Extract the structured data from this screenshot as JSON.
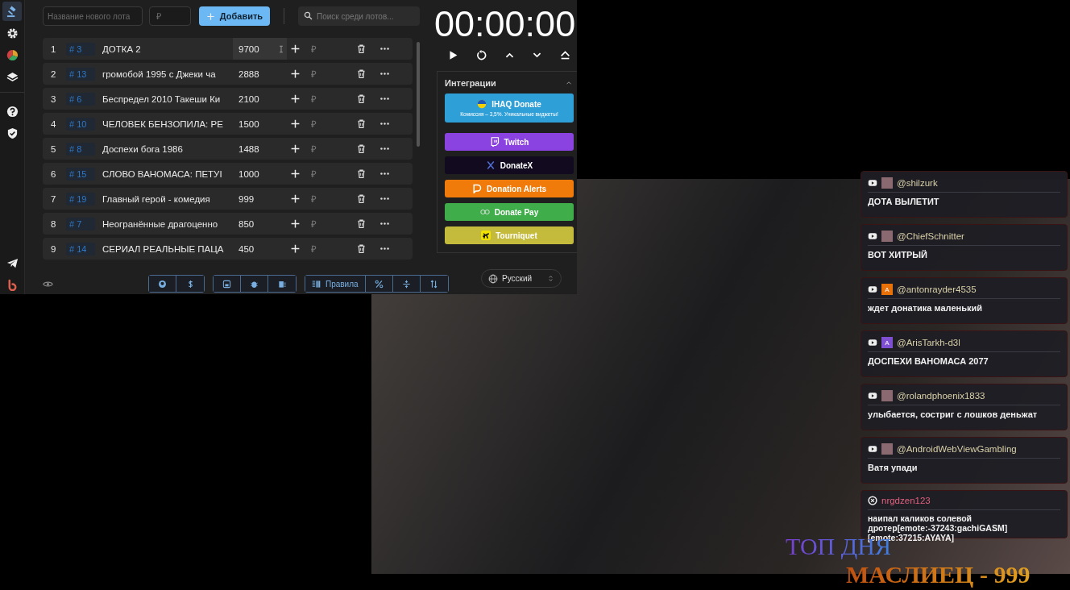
{
  "sidebar": {
    "items": [
      {
        "kind": "gavel",
        "selected": true
      },
      {
        "kind": "gear",
        "selected": false
      },
      {
        "kind": "pie",
        "selected": false
      },
      {
        "kind": "layers",
        "selected": false
      },
      {
        "kind": "help",
        "selected": false
      },
      {
        "kind": "shield",
        "selected": false
      },
      {
        "kind": "telegram",
        "selected": false
      },
      {
        "kind": "brand",
        "selected": false
      }
    ]
  },
  "new_lot": {
    "name_placeholder": "Название нового лота",
    "amount_placeholder": "₽",
    "add_button": "Добавить"
  },
  "search": {
    "placeholder": "Поиск среди лотов..."
  },
  "lots": [
    {
      "index": "1",
      "number": "# 3",
      "name": "ДОТКА 2",
      "amount": "9700",
      "highlighted": true
    },
    {
      "index": "2",
      "number": "# 13",
      "name": "громобой 1995 с Джеки ча",
      "amount": "2888",
      "highlighted": false
    },
    {
      "index": "3",
      "number": "# 6",
      "name": "Беспредел 2010 Такеши Ки",
      "amount": "2100",
      "highlighted": false
    },
    {
      "index": "4",
      "number": "# 10",
      "name": " ЧЕЛОВЕК БЕНЗОПИЛА: РЕ",
      "amount": "1500",
      "highlighted": false
    },
    {
      "index": "5",
      "number": "# 8",
      "name": "Доспехи бога 1986",
      "amount": "1488",
      "highlighted": false
    },
    {
      "index": "6",
      "number": "# 15",
      "name": "СЛОВО ВАНОМАСА: ПЕТУІ",
      "amount": "1000",
      "highlighted": false
    },
    {
      "index": "7",
      "number": "# 19",
      "name": "Главный герой - комедия",
      "amount": "999",
      "highlighted": false
    },
    {
      "index": "8",
      "number": "# 7",
      "name": "Неогранённые драгоценно",
      "amount": "850",
      "highlighted": false
    },
    {
      "index": "9",
      "number": "# 14",
      "name": "СЕРИАЛ РЕАЛЬНЫЕ ПАЦА",
      "amount": "450",
      "highlighted": false
    }
  ],
  "lot_currency": "₽",
  "toolbar": {
    "groups": [
      {
        "buttons": [
          {
            "kind": "github"
          },
          {
            "kind": "dollar"
          }
        ]
      },
      {
        "buttons": [
          {
            "kind": "save"
          },
          {
            "kind": "bug"
          },
          {
            "kind": "archive"
          }
        ]
      },
      {
        "buttons": [
          {
            "kind": "rules",
            "label": "Правила"
          },
          {
            "kind": "percent"
          },
          {
            "kind": "split"
          },
          {
            "kind": "sort"
          }
        ]
      }
    ]
  },
  "language": {
    "value": "Русский"
  },
  "timer": {
    "time": "00:00:00",
    "controls": [
      {
        "kind": "play"
      },
      {
        "kind": "reset"
      },
      {
        "kind": "up"
      },
      {
        "kind": "down"
      },
      {
        "kind": "eject"
      }
    ]
  },
  "integrations": {
    "title": "Интеграции",
    "expanded": true,
    "items": [
      {
        "kind": "ihaq",
        "label": "IHAQ Donate",
        "subtitle": "Комиссия – 3,5%. Уникальные виджеты!",
        "color": "#2f9fd8"
      },
      {
        "kind": "twitch",
        "label": "Twitch",
        "color": "#8a43e0"
      },
      {
        "kind": "donatex",
        "label": "DonateX",
        "color": "#120a1e"
      },
      {
        "kind": "alerts",
        "label": "Donation Alerts",
        "color": "#f07a0a"
      },
      {
        "kind": "pay",
        "label": "Donate Pay",
        "color": "#3fae4a"
      },
      {
        "kind": "tourniquet",
        "label": "Tourniquet",
        "color": "#c4bb3c"
      }
    ]
  },
  "chat": [
    {
      "kind": "youtube",
      "avatar": {
        "kind": "image"
      },
      "user": "@shilzurk",
      "text": "ДОТА ВЫЛЕТИТ",
      "color": "#d8cfa8"
    },
    {
      "kind": "youtube",
      "avatar": {
        "kind": "image"
      },
      "user": "@ChiefSchnitter",
      "text": "ВОТ ХИТРЫЙ",
      "color": "#d8cfa8"
    },
    {
      "kind": "youtube",
      "avatar": {
        "kind": "letter",
        "letter": "A",
        "color": "#e8710a"
      },
      "user": "@antonrayder4535",
      "text": "ждет донатика маленький",
      "color": "#d8cfa8"
    },
    {
      "kind": "youtube",
      "avatar": {
        "kind": "letter",
        "letter": "A",
        "color": "#7e4fd0"
      },
      "user": "@ArisTarkh-d3l",
      "text": "ДОСПЕХИ ВАНОМАСА 2077",
      "color": "#d8cfa8"
    },
    {
      "kind": "youtube",
      "avatar": {
        "kind": "image"
      },
      "user": "@rolandphoenix1833",
      "text": "улыбается, состриг с лошков деньжат",
      "color": "#d8cfa8"
    },
    {
      "kind": "youtube",
      "avatar": {
        "kind": "image"
      },
      "user": "@AndroidWebViewGambling",
      "text": "Ватя упади",
      "color": "#d8cfa8"
    },
    {
      "kind": "other",
      "user": "nrgdzen123",
      "text": "наипал каликов солевой дротер[emote:-37243:gachiGASM][emote:37215:AYAYA]",
      "color": "#e0607c"
    }
  ],
  "top_of_day": {
    "title": "ТОП ДНЯ",
    "leader": "МАСЛИЕЦ - 999"
  }
}
